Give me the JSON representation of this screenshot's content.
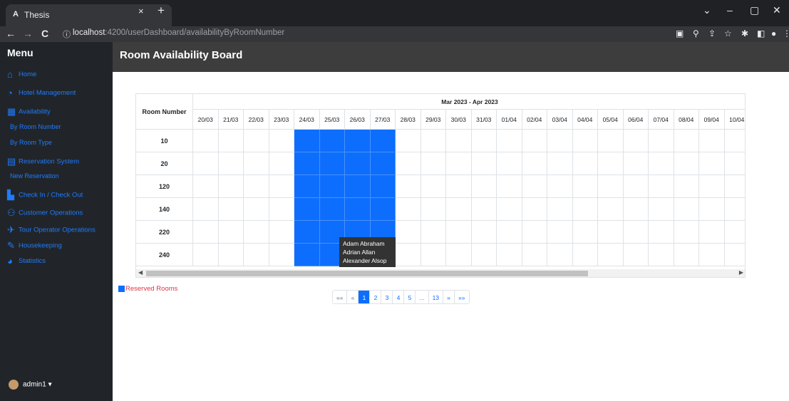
{
  "browser": {
    "tab_title": "Thesis",
    "favicon": "A",
    "close": "×",
    "new_tab": "+",
    "url_host": "localhost",
    "url_path": ":4200/userDashboard/availabilityByRoomNumber",
    "back": "←",
    "forward": "→",
    "reload": "C",
    "info": "ⓘ",
    "minimize": "–",
    "maximize": "▢",
    "window_close": "✕",
    "chevron": "⌄"
  },
  "sidebar": {
    "title": "Menu",
    "items": [
      {
        "label": "Home",
        "icon": "home-icon"
      },
      {
        "label": "Hotel Management",
        "icon": "dashboard-icon"
      },
      {
        "label": "Availability",
        "icon": "calendar-table-icon"
      },
      {
        "label": "Reservation System",
        "icon": "calendar-icon"
      },
      {
        "label": "Check In / Check Out",
        "icon": "bed-icon"
      },
      {
        "label": "Customer Operations",
        "icon": "users-icon"
      },
      {
        "label": "Tour Operator Operations",
        "icon": "plane-icon"
      },
      {
        "label": "Housekeeping",
        "icon": "broom-icon"
      },
      {
        "label": "Statistics",
        "icon": "chart-pie-icon"
      }
    ],
    "sub_availability": [
      "By Room Number",
      "By Room Type"
    ],
    "sub_reservation": [
      "New Reservation"
    ],
    "user": "admin1 ▾"
  },
  "header": {
    "title": "Room Availability Board"
  },
  "grid": {
    "room_header": "Room Number",
    "month_label": "Mar 2023 - Apr 2023",
    "dates": [
      "20/03",
      "21/03",
      "22/03",
      "23/03",
      "24/03",
      "25/03",
      "26/03",
      "27/03",
      "28/03",
      "29/03",
      "30/03",
      "31/03",
      "01/04",
      "02/04",
      "03/04",
      "04/04",
      "05/04",
      "06/04",
      "07/04",
      "08/04",
      "09/04",
      "10/04"
    ],
    "rooms": [
      "10",
      "20",
      "120",
      "140",
      "220",
      "240"
    ],
    "reserved_date_indices": [
      4,
      5,
      6,
      7
    ],
    "reserved_color": "#0d6efd"
  },
  "tooltip": {
    "lines": [
      "Adam Abraham",
      "Adrian Allan",
      "Alexander Alsop"
    ]
  },
  "legend": {
    "label": "Reserved Rooms"
  },
  "pagination": {
    "items": [
      "««",
      "«",
      "1",
      "2",
      "3",
      "4",
      "5",
      "...",
      "13",
      "»",
      "»»"
    ],
    "active": "1"
  }
}
